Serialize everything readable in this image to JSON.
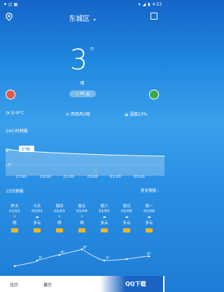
{
  "status": {
    "time": "4:53"
  },
  "header": {
    "city": "东城区",
    "dropdown": "▾"
  },
  "current": {
    "temperature": "3",
    "degree_symbol": "°",
    "condition": "晴",
    "aqi_value": "65",
    "aqi_label": "良"
  },
  "stats": {
    "range": "3/-8°C",
    "wind": "西南风2级",
    "humidity": "湿度23%"
  },
  "hourly": {
    "title": "24小时预报",
    "temp_high": "6°",
    "temp_low": "-7°",
    "tooltip": "0°晴",
    "times": [
      "17:00",
      "19:00",
      "21:00",
      "23:00",
      "01:00",
      "03:00"
    ]
  },
  "daily": {
    "title": "15日预报",
    "more_label": "更多预报",
    "days": [
      {
        "name": "昨天",
        "date": "01/01",
        "cond": "晴",
        "high": "4°"
      },
      {
        "name": "今天",
        "date": "01/02",
        "cond": "多云",
        "high": "3°"
      },
      {
        "name": "周四",
        "date": "01/03",
        "cond": "晴",
        "high": "6°"
      },
      {
        "name": "周五",
        "date": "01/04",
        "cond": "晴",
        "high": "8°"
      },
      {
        "name": "周六",
        "date": "01/05",
        "cond": "多云",
        "high": "3°"
      },
      {
        "name": "周日",
        "date": "01/06",
        "cond": "多云",
        "high": "4°"
      },
      {
        "name": "周一",
        "date": "01/06",
        "cond": "多云",
        "high": "4°"
      }
    ]
  },
  "tabs": {
    "calendar": "日历",
    "recommend": "黄历",
    "watermark": "QQ下载"
  },
  "colors": {
    "accent": "#1e86de",
    "badge": "#f1b625",
    "aqi_ok": "#38a84a"
  }
}
